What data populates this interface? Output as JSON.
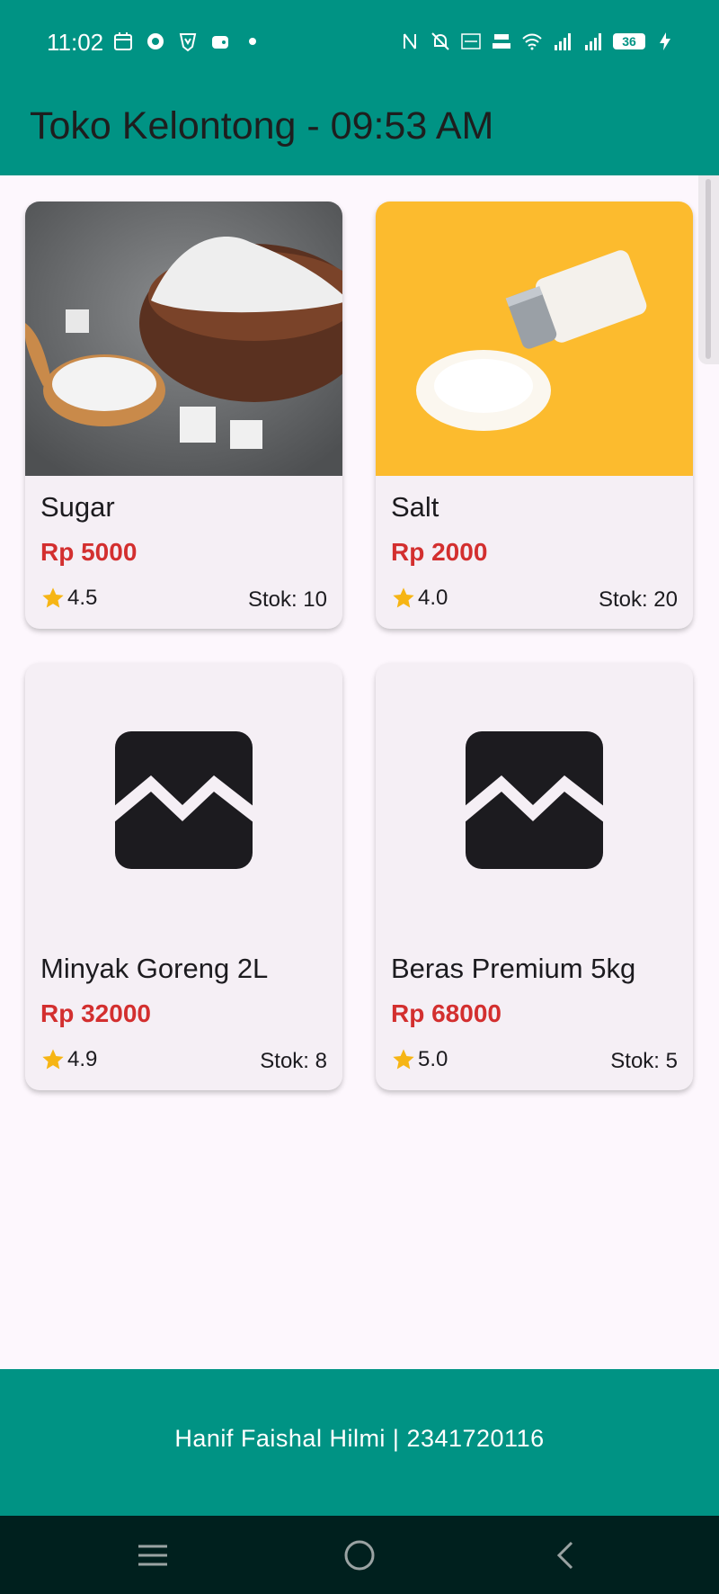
{
  "status_bar": {
    "time": "11:02",
    "battery": "36",
    "left_icons": [
      "calendar-icon",
      "location-icon",
      "brave-icon",
      "wallet-icon",
      "dot-icon"
    ],
    "right_icons": [
      "nfc-icon",
      "mute-icon",
      "volte-icon",
      "data-speed-icon",
      "wifi-icon",
      "signal-icon",
      "signal-icon",
      "battery-icon",
      "charging-icon"
    ]
  },
  "app_bar": {
    "title": "Toko Kelontong - 09:53 AM",
    "background": "#009384"
  },
  "products": [
    {
      "name": "Sugar",
      "price": "Rp 5000",
      "rating": "4.5",
      "stock": "Stok: 10",
      "image": "sugar-photo"
    },
    {
      "name": "Salt",
      "price": "Rp 2000",
      "rating": "4.0",
      "stock": "Stok: 20",
      "image": "salt-photo"
    },
    {
      "name": "Minyak Goreng 2L",
      "price": "Rp 32000",
      "rating": "4.9",
      "stock": "Stok: 8",
      "image": "broken-image-icon"
    },
    {
      "name": "Beras Premium 5kg",
      "price": "Rp 68000",
      "rating": "5.0",
      "stock": "Stok: 5",
      "image": "broken-image-icon"
    }
  ],
  "footer": {
    "text": "Hanif Faishal Hilmi | 2341720116"
  },
  "nav_bar": {
    "buttons": [
      "menu-icon",
      "home-icon",
      "back-icon"
    ]
  },
  "colors": {
    "primary": "#009384",
    "price": "#d32f2f",
    "star": "#f6b515",
    "card": "#f5eff5"
  }
}
